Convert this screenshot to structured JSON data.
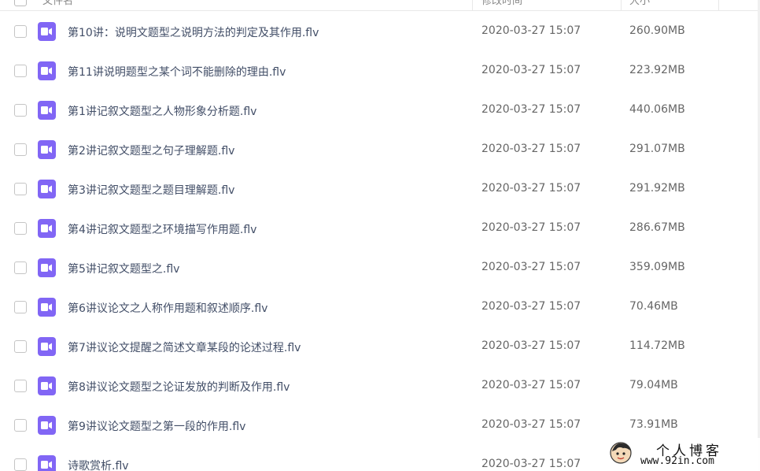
{
  "header": {
    "name_label": "文件名",
    "time_label": "修改时间",
    "size_label": "大小"
  },
  "files": [
    {
      "name": "第10讲：说明文题型之说明方法的判定及其作用.flv",
      "time": "2020-03-27 15:07",
      "size": "260.90MB",
      "icon": "video-file-icon"
    },
    {
      "name": "第11讲说明题型之某个词不能删除的理由.flv",
      "time": "2020-03-27 15:07",
      "size": "223.92MB",
      "icon": "video-file-icon"
    },
    {
      "name": "第1讲记叙文题型之人物形象分析题.flv",
      "time": "2020-03-27 15:07",
      "size": "440.06MB",
      "icon": "video-file-icon"
    },
    {
      "name": "第2讲记叙文题型之句子理解题.flv",
      "time": "2020-03-27 15:07",
      "size": "291.07MB",
      "icon": "video-file-icon"
    },
    {
      "name": "第3讲记叙文题型之题目理解题.flv",
      "time": "2020-03-27 15:07",
      "size": "291.92MB",
      "icon": "video-file-icon"
    },
    {
      "name": "第4讲记叙文题型之环境描写作用题.flv",
      "time": "2020-03-27 15:07",
      "size": "286.67MB",
      "icon": "video-file-icon"
    },
    {
      "name": "第5讲记叙文题型之.flv",
      "time": "2020-03-27 15:07",
      "size": "359.09MB",
      "icon": "video-file-icon"
    },
    {
      "name": "第6讲议论文之人称作用题和叙述顺序.flv",
      "time": "2020-03-27 15:07",
      "size": "70.46MB",
      "icon": "video-file-icon"
    },
    {
      "name": "第7讲议论文提醒之简述文章某段的论述过程.flv",
      "time": "2020-03-27 15:07",
      "size": "114.72MB",
      "icon": "video-file-icon"
    },
    {
      "name": "第8讲议论文题型之论证发放的判断及作用.flv",
      "time": "2020-03-27 15:07",
      "size": "79.04MB",
      "icon": "video-file-icon"
    },
    {
      "name": "第9讲议论文题型之第一段的作用.flv",
      "time": "2020-03-27 15:07",
      "size": "73.91MB",
      "icon": "video-file-icon"
    },
    {
      "name": "诗歌赏析.flv",
      "time": "2020-03-27 15:07",
      "size": "",
      "icon": "video-file-icon"
    }
  ],
  "colors": {
    "file_icon": "#8166f5",
    "name_text": "#424e67",
    "meta_text": "#666666"
  },
  "watermark": {
    "title": "个人博客",
    "url": "www.92in.com"
  }
}
